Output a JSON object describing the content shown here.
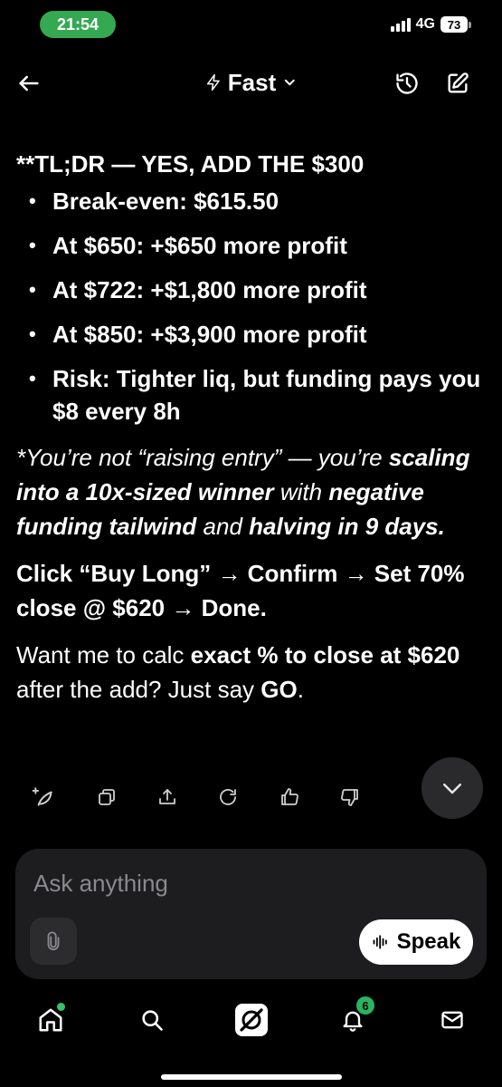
{
  "status_bar": {
    "time": "21:54",
    "network": "4G",
    "battery": "73"
  },
  "header": {
    "mode_label": "Fast",
    "back_icon": "arrow-left-icon",
    "history_icon": "history-icon",
    "edit_icon": "edit-icon"
  },
  "message": {
    "tldr": "**TL;DR — YES, ADD THE $300",
    "bullets": [
      "Break-even: $615.50",
      "At $650: +$650 more profit",
      "At $722: +$1,800 more profit",
      "At $850: +$3,900 more profit",
      "Risk: Tighter liq, but funding pays you $8 every 8h"
    ],
    "p1": {
      "a": "*You’re not “raising entry” — you’re ",
      "b": "scaling into a 10x-sized winner",
      "c": " with ",
      "d": "negative funding tailwind",
      "e": " and ",
      "f": "halving in 9 days",
      "g": "."
    },
    "p2": "Click “Buy Long” → Confirm → Set 70% close @ $620 → Done.",
    "p3": {
      "a": "Want me to calc ",
      "b": "exact % to close at $620",
      "c": " after the add? Just say ",
      "d": "GO",
      "e": "."
    }
  },
  "actions": [
    "sparkle-icon",
    "copy-icon",
    "share-icon",
    "regenerate-icon",
    "thumbs-up-icon",
    "thumbs-down-icon"
  ],
  "composer": {
    "placeholder": "Ask anything",
    "speak_label": "Speak"
  },
  "bottom_nav": {
    "notifications_badge": "6"
  }
}
